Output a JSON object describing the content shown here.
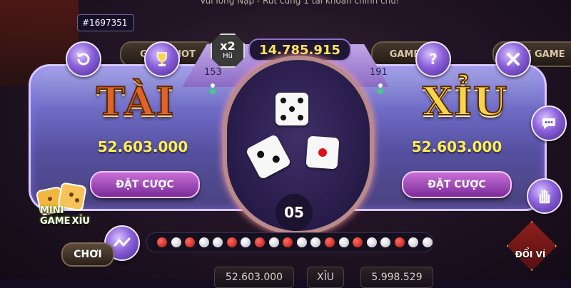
{
  "background": {
    "top_banner": "Vui lòng Nạp - Rút cùng 1 tài khoản chính chủ!",
    "tabs": [
      "GAME HOT",
      "GAME",
      "LIVE GAME"
    ],
    "bottom_values": [
      "52.603.000",
      "5.998.529"
    ],
    "bottom_label": "XỈU"
  },
  "session_id": "#1697351",
  "jackpot": {
    "multiplier": "x2",
    "label": "Hũ",
    "amount": "14.785.915"
  },
  "tai": {
    "title": "TÀI",
    "players": "153",
    "total": "52.603.000",
    "bet_label": "ĐẶT CƯỢC"
  },
  "xiu": {
    "title": "XỈU",
    "players": "191",
    "total": "52.603.000",
    "bet_label": "ĐẶT CƯỢC"
  },
  "dice": [
    5,
    2,
    1
  ],
  "countdown": "05",
  "history": [
    "tai",
    "xiu",
    "tai",
    "xiu",
    "xiu",
    "tai",
    "xiu",
    "tai",
    "xiu",
    "tai",
    "xiu",
    "xiu",
    "tai",
    "xiu",
    "tai",
    "xiu",
    "xiu",
    "tai",
    "xiu",
    "xiu"
  ],
  "mini_game": {
    "line1": "MINI",
    "line2": "GAME",
    "line3": "XỈU",
    "play": "CHƠI"
  },
  "wallet_label": "ĐỔI VÍ",
  "icons": {
    "history": "history-refresh-icon",
    "ranking": "trophy-icon",
    "help": "question-icon",
    "close": "close-x-icon",
    "chat": "chat-bubble-icon",
    "hand": "hand-icon",
    "stats": "trend-line-icon"
  },
  "colors": {
    "panel": "#6f6cc7",
    "tai_title": "#e0632a",
    "xiu_title": "#f6d44c",
    "total_text": "#ffee52",
    "jackpot_text": "#ffe35a"
  }
}
